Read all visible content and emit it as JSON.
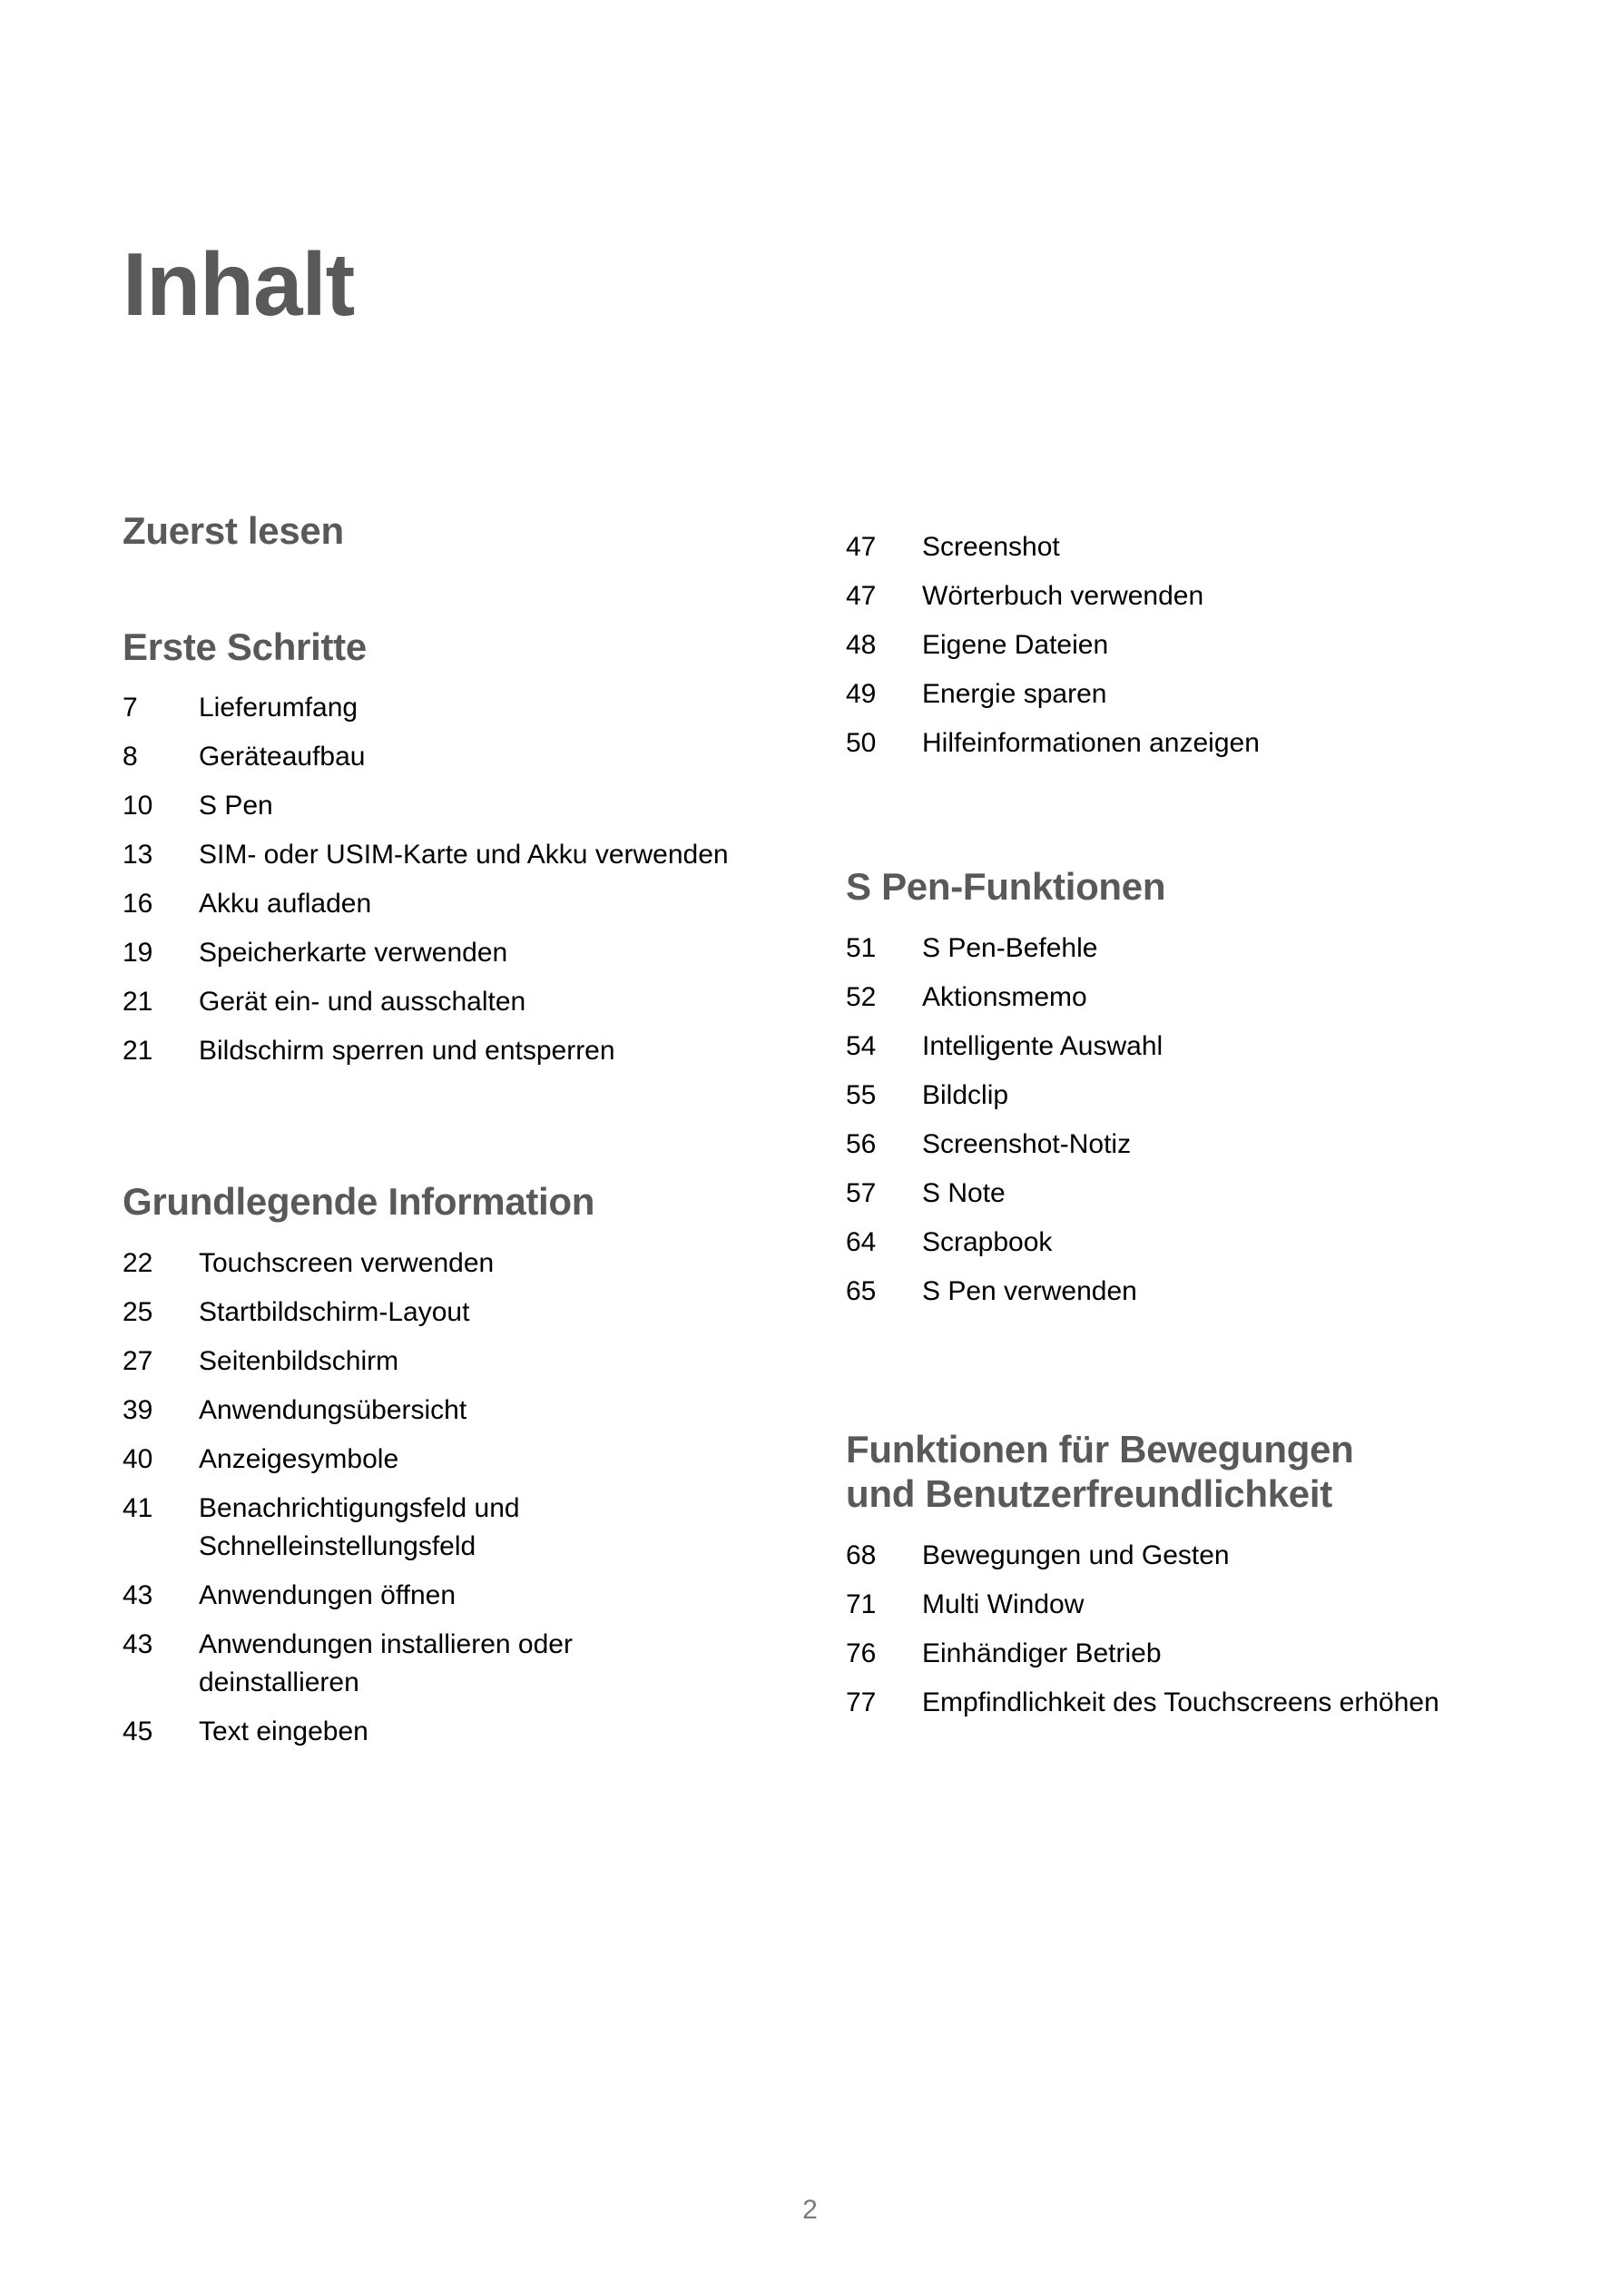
{
  "document": {
    "title": "Inhalt",
    "page_number": "2",
    "heading_color": "#595959",
    "text_color": "#000000",
    "page_number_color": "#7a7a7a",
    "background_color": "#ffffff"
  },
  "columns": {
    "left": [
      {
        "heading": "Zuerst lesen",
        "entries": []
      },
      {
        "heading": "Erste Schritte",
        "entries": [
          {
            "page": "7",
            "title": "Lieferumfang"
          },
          {
            "page": "8",
            "title": "Geräteaufbau"
          },
          {
            "page": "10",
            "title": "S Pen"
          },
          {
            "page": "13",
            "title": "SIM- oder USIM-Karte und Akku verwenden"
          },
          {
            "page": "16",
            "title": "Akku aufladen"
          },
          {
            "page": "19",
            "title": "Speicherkarte verwenden"
          },
          {
            "page": "21",
            "title": "Gerät ein- und ausschalten"
          },
          {
            "page": "21",
            "title": "Bildschirm sperren und entsperren"
          }
        ]
      },
      {
        "heading": "Grundlegende Information",
        "entries": [
          {
            "page": "22",
            "title": "Touchscreen verwenden"
          },
          {
            "page": "25",
            "title": "Startbildschirm-Layout"
          },
          {
            "page": "27",
            "title": "Seitenbildschirm"
          },
          {
            "page": "39",
            "title": "Anwendungsübersicht"
          },
          {
            "page": "40",
            "title": "Anzeigesymbole"
          },
          {
            "page": "41",
            "title": "Benachrichtigungsfeld und\nSchnelleinstellungsfeld"
          },
          {
            "page": "43",
            "title": "Anwendungen öffnen"
          },
          {
            "page": "43",
            "title": "Anwendungen installieren oder\ndeinstallieren"
          },
          {
            "page": "45",
            "title": "Text eingeben"
          }
        ]
      }
    ],
    "right": [
      {
        "heading": "",
        "entries": [
          {
            "page": "47",
            "title": "Screenshot"
          },
          {
            "page": "47",
            "title": "Wörterbuch verwenden"
          },
          {
            "page": "48",
            "title": "Eigene Dateien"
          },
          {
            "page": "49",
            "title": "Energie sparen"
          },
          {
            "page": "50",
            "title": "Hilfeinformationen anzeigen"
          }
        ]
      },
      {
        "heading": "S Pen-Funktionen",
        "entries": [
          {
            "page": "51",
            "title": "S Pen-Befehle"
          },
          {
            "page": "52",
            "title": "Aktionsmemo"
          },
          {
            "page": "54",
            "title": "Intelligente Auswahl"
          },
          {
            "page": "55",
            "title": "Bildclip"
          },
          {
            "page": "56",
            "title": "Screenshot-Notiz"
          },
          {
            "page": "57",
            "title": "S Note"
          },
          {
            "page": "64",
            "title": "Scrapbook"
          },
          {
            "page": "65",
            "title": "S Pen verwenden"
          }
        ]
      },
      {
        "heading": "Funktionen für Bewegungen\nund Benutzerfreundlichkeit",
        "entries": [
          {
            "page": "68",
            "title": "Bewegungen und Gesten"
          },
          {
            "page": "71",
            "title": "Multi Window"
          },
          {
            "page": "76",
            "title": "Einhändiger Betrieb"
          },
          {
            "page": "77",
            "title": "Empfindlichkeit des Touchscreens erhöhen"
          }
        ]
      }
    ]
  }
}
